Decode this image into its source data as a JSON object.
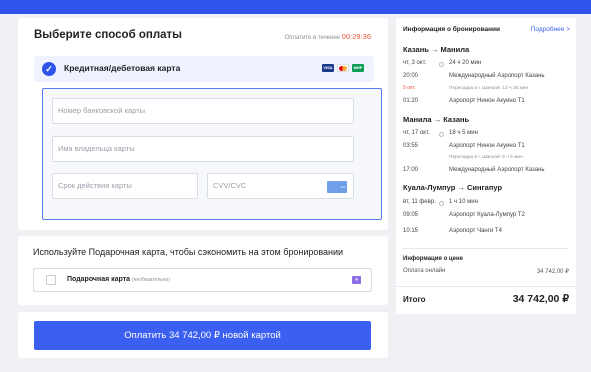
{
  "payment": {
    "title": "Выберите способ оплаты",
    "timer_label": "Оплатите в течение",
    "timer_value": "00:29:36",
    "method_label": "Кредитная/дебетовая карта",
    "brands": [
      "VISA",
      "MC",
      "МИР"
    ],
    "fields": {
      "card_number": "Номер банковской карты",
      "holder": "Имя владельца карты",
      "expiry": "Срок действия карты",
      "cvv": "CVV/CVC"
    }
  },
  "gift": {
    "title": "Используйте Подарочная карта, чтобы сэкономить на этом бронировании",
    "label": "Подарочная карта",
    "optional": "(необязательно)"
  },
  "pay_button": "Оплатить 34 742,00 ₽ новой картой",
  "booking": {
    "title": "Информация о бронировании",
    "more": "Подробнее >",
    "legs": [
      {
        "route": "Казань → Манила",
        "date": "чт, 3 окт.",
        "duration": "24 ч 20 мин",
        "dep_time": "20:00",
        "dep_airport": "Международный Аэропорт Казань",
        "transfer": "Пересадка в г. Шанхай: 12 ч 35 мин",
        "next_day": "5 окт.",
        "arr_time": "01:20",
        "arr_airport": "Аэропорт Нинон Акуино T1"
      },
      {
        "route": "Манила → Казань",
        "date": "чт, 17 окт.",
        "duration": "18 ч 5 мин",
        "dep_time": "03:55",
        "dep_airport": "Аэропорт Нинон Акуино T1",
        "transfer": "Пересадка в г. Шанхай: 5 ч 5 мин",
        "arr_time": "17:00",
        "arr_airport": "Международный Аэропорт Казань"
      },
      {
        "route": "Куала-Лумпур → Сингапур",
        "date": "вт, 11 февр.",
        "duration": "1 ч 10 мин",
        "dep_time": "09:05",
        "dep_airport": "Аэропорт Куала-Лумпур T2",
        "arr_time": "10:15",
        "arr_airport": "Аэропорт Чанги T4"
      }
    ],
    "price_title": "Информация о цене",
    "price_label": "Оплата онлайн",
    "price_value": "34 742,00 ₽",
    "total_label": "Итого",
    "total_value": "34 742,00 ₽"
  },
  "colors": {
    "accent": "#3b5ff0",
    "timer": "#e8553c",
    "background": "#f0f1f4"
  }
}
